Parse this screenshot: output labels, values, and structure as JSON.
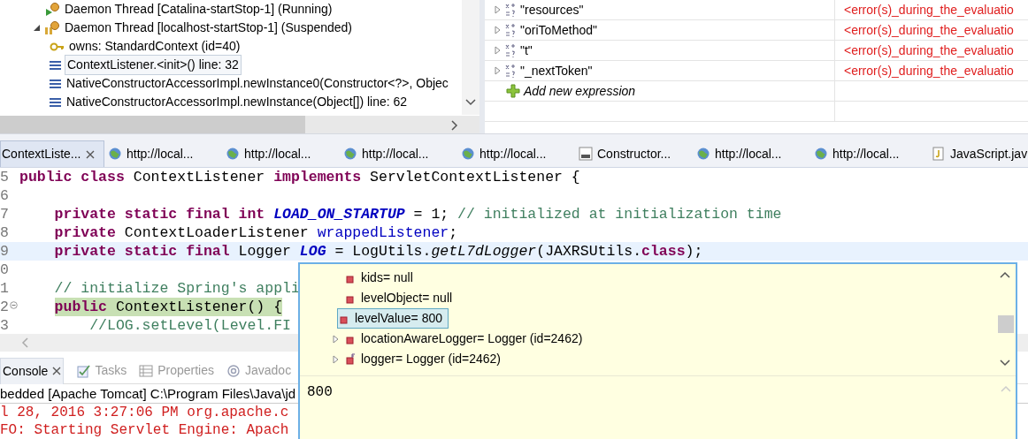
{
  "debug_view": {
    "threads": [
      {
        "kind": "running",
        "label": "Daemon Thread [Catalina-startStop-1] (Running)"
      },
      {
        "kind": "suspended",
        "label": "Daemon Thread [localhost-startStop-1] (Suspended)",
        "expanded": true,
        "children": [
          {
            "kind": "monitor",
            "label": "owns: StandardContext  (id=40)",
            "selected": false
          },
          {
            "kind": "frame",
            "label": "ContextListener.<init>() line: 32",
            "selected": true
          },
          {
            "kind": "frame",
            "label": "NativeConstructorAccessorImpl.newInstance0(Constructor<?>, Objec",
            "selected": false
          },
          {
            "kind": "frame",
            "label": "NativeConstructorAccessorImpl.newInstance(Object[]) line: 62",
            "selected": false
          }
        ]
      }
    ]
  },
  "expressions": {
    "rows": [
      {
        "name": "\"resources\"",
        "value": "<error(s)_during_the_evaluatio"
      },
      {
        "name": "\"oriToMethod\"",
        "value": "<error(s)_during_the_evaluatio"
      },
      {
        "name": "\"t\"",
        "value": "<error(s)_during_the_evaluatio"
      },
      {
        "name": "\"_nextToken\"",
        "value": "<error(s)_during_the_evaluatio"
      }
    ],
    "add_label": "Add new expression"
  },
  "editor_tabs": [
    {
      "label": "ContextListe...",
      "selected": true
    },
    {
      "label": "http://local...",
      "kind": "web",
      "selected": false
    },
    {
      "label": "http://local...",
      "kind": "web",
      "selected": false
    },
    {
      "label": "http://local...",
      "kind": "web",
      "selected": false
    },
    {
      "label": "http://local...",
      "kind": "web",
      "selected": false
    },
    {
      "label": "Constructor...",
      "kind": "class",
      "selected": false
    },
    {
      "label": "http://local...",
      "kind": "web",
      "selected": false
    },
    {
      "label": "http://local...",
      "kind": "web",
      "selected": false
    },
    {
      "label": "JavaScript.jav",
      "kind": "js",
      "selected": false
    }
  ],
  "code": {
    "lines": [
      {
        "number": "5",
        "cursor_line": false,
        "tokens": [
          {
            "text": "public class ",
            "kind": "keyword"
          },
          {
            "text": "ContextListener ",
            "kind": "plain"
          },
          {
            "text": "implements ",
            "kind": "keyword"
          },
          {
            "text": "ServletContextListener {",
            "kind": "plain"
          }
        ]
      },
      {
        "number": "6",
        "cursor_line": false
      },
      {
        "number": "7",
        "cursor_line": false,
        "tokens": [
          {
            "text": "    private static final int ",
            "kind": "keyword"
          },
          {
            "text": "LOAD_ON_STARTUP",
            "kind": "constant"
          },
          {
            "text": " = 1; ",
            "kind": "plain"
          },
          {
            "text": "// initialized at initialization time",
            "kind": "comment"
          }
        ]
      },
      {
        "number": "8",
        "cursor_line": false,
        "tokens": [
          {
            "text": "    private ",
            "kind": "keyword"
          },
          {
            "text": "ContextLoaderListener ",
            "kind": "plain"
          },
          {
            "text": "wrappedListener",
            "kind": "field"
          },
          {
            "text": ";",
            "kind": "plain"
          }
        ]
      },
      {
        "number": "9",
        "cursor_line": true,
        "tokens": [
          {
            "text": "    private static final ",
            "kind": "keyword"
          },
          {
            "text": "Logger ",
            "kind": "plain"
          },
          {
            "text": "LOG",
            "kind": "constant"
          },
          {
            "text": " = LogUtils.",
            "kind": "plain"
          },
          {
            "text": "getL7dLogger",
            "kind": "static_method"
          },
          {
            "text": "(JAXRSUtils.",
            "kind": "plain"
          },
          {
            "text": "class",
            "kind": "keyword"
          },
          {
            "text": ");",
            "kind": "plain"
          }
        ]
      },
      {
        "number": "0",
        "cursor_line": false
      },
      {
        "number": "1",
        "cursor_line": false,
        "tokens": [
          {
            "text": "    // initialize Spring's appli",
            "kind": "comment"
          }
        ]
      },
      {
        "number": "2",
        "cursor_line": false,
        "execution_point": true,
        "fold": true,
        "tokens": [
          {
            "text": "public ",
            "kind": "keyword"
          },
          {
            "text": "ContextListener() {",
            "kind": "plain"
          }
        ]
      },
      {
        "number": "3",
        "cursor_line": false,
        "tokens": [
          {
            "text": "        //LOG.setLevel(Level.FI",
            "kind": "comment"
          }
        ]
      }
    ]
  },
  "console": {
    "tabs": [
      {
        "label": "Console",
        "kind": "console",
        "selected": true
      },
      {
        "label": "Tasks",
        "kind": "tasks",
        "selected": false
      },
      {
        "label": "Properties",
        "kind": "properties",
        "selected": false
      },
      {
        "label": "Javadoc",
        "kind": "javadoc",
        "selected": false
      }
    ],
    "launch": "bedded [Apache Tomcat] C:\\Program Files\\Java\\jd",
    "lines": [
      "l 28, 2016 3:27:06 PM org.apache.c",
      "FO: Starting Servlet Engine: Apach"
    ]
  },
  "hover_popup": {
    "variables": [
      {
        "label": "kids= null",
        "kind": "field",
        "expandable": false,
        "selected": false
      },
      {
        "label": "levelObject= null",
        "kind": "field",
        "expandable": false,
        "selected": false
      },
      {
        "label": "levelValue= 800",
        "kind": "field",
        "expandable": false,
        "selected": true
      },
      {
        "label": "locationAwareLogger= Logger  (id=2462)",
        "kind": "field",
        "expandable": true,
        "selected": false
      },
      {
        "label": "logger= Logger  (id=2462)",
        "kind": "final_field",
        "expandable": true,
        "selected": false
      }
    ],
    "detail": "800"
  }
}
